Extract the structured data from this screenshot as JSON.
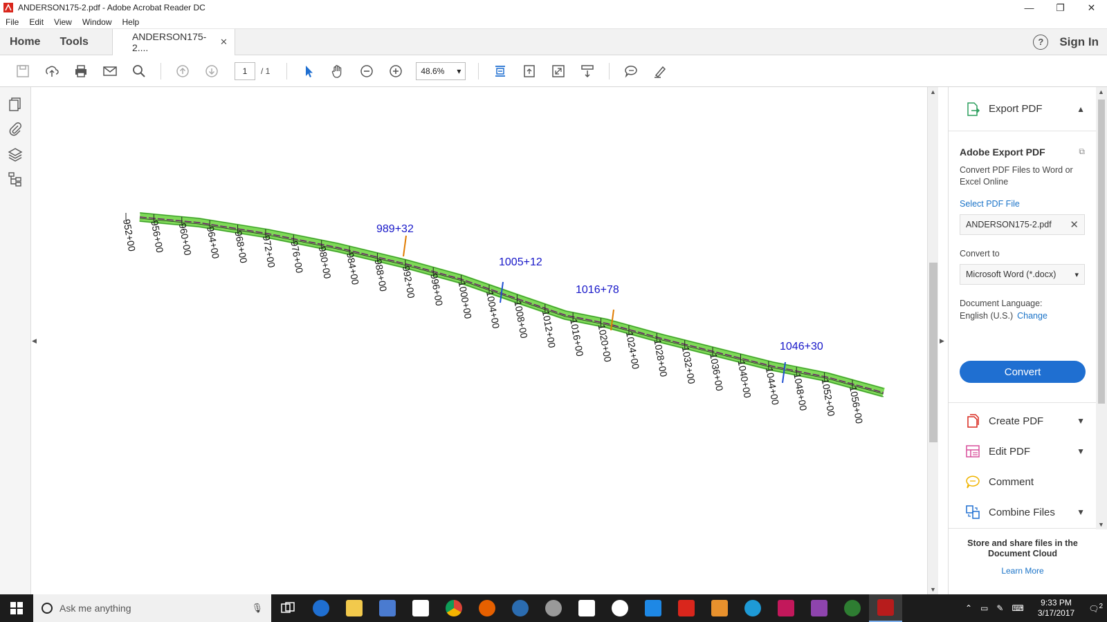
{
  "window": {
    "title": "ANDERSON175-2.pdf - Adobe Acrobat Reader DC",
    "minimize": "—",
    "maximize": "❐",
    "close": "✕"
  },
  "menu": [
    "File",
    "Edit",
    "View",
    "Window",
    "Help"
  ],
  "tabs": {
    "home": "Home",
    "tools": "Tools",
    "document": "ANDERSON175-2....",
    "close": "✕",
    "help": "?",
    "sign_in": "Sign In"
  },
  "toolbar": {
    "page_current": "1",
    "page_total": "/ 1",
    "zoom": "48.6%"
  },
  "drawing": {
    "stations": [
      "952+00",
      "956+00",
      "960+00",
      "964+00",
      "968+00",
      "972+00",
      "976+00",
      "980+00",
      "984+00",
      "988+00",
      "992+00",
      "996+00",
      "1000+00",
      "1004+00",
      "1008+00",
      "1012+00",
      "1016+00",
      "1020+00",
      "1024+00",
      "1028+00",
      "1032+00",
      "1036+00",
      "1040+00",
      "1044+00",
      "1048+00",
      "1052+00",
      "1056+00"
    ],
    "callouts": [
      "989+32",
      "1005+12",
      "1016+78",
      "1046+30"
    ],
    "colors": {
      "callout": "#1515c8",
      "band": "#7ed957",
      "band_edge": "#3a9a2c",
      "centerline": "#6a1b6a"
    }
  },
  "panel": {
    "export_title": "Export PDF",
    "adobe_export": "Adobe Export PDF",
    "description": "Convert PDF Files to Word or Excel Online",
    "select_file": "Select PDF File",
    "file_name": "ANDERSON175-2.pdf",
    "convert_to_label": "Convert to",
    "convert_to_value": "Microsoft Word (*.docx)",
    "doc_language_label": "Document Language:",
    "doc_language_value": "English (U.S.)",
    "change": "Change",
    "convert_button": "Convert",
    "tools": [
      {
        "label": "Create PDF",
        "icon": "create-pdf-icon"
      },
      {
        "label": "Edit PDF",
        "icon": "edit-pdf-icon"
      },
      {
        "label": "Comment",
        "icon": "comment-icon"
      },
      {
        "label": "Combine Files",
        "icon": "combine-files-icon"
      }
    ],
    "cloud_text": "Store and share files in the Document Cloud",
    "learn_more": "Learn More"
  },
  "taskbar": {
    "search_placeholder": "Ask me anything",
    "time": "9:33 PM",
    "date": "3/17/2017",
    "notifications": "2"
  }
}
